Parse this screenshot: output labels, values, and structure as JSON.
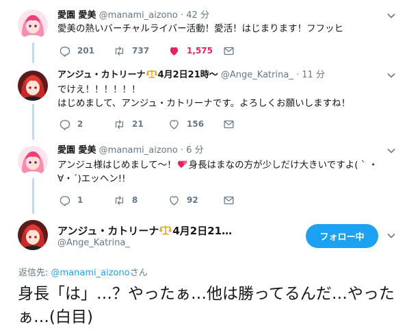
{
  "tweets": [
    {
      "name": "愛園 愛美",
      "handle": "@manami_aizono",
      "sep": "·",
      "time": "42 分",
      "lines": [
        "愛美の熱いバーチャルライバー活動！愛活！はじまります！フフッヒ"
      ],
      "replies": "201",
      "retweets": "737",
      "likes": "1,575",
      "liked": true
    },
    {
      "name": "アンジュ・カトリーナ",
      "name_suffix": "4月2日21時〜",
      "handle": "@Ange_Katrina_",
      "sep": "·",
      "time": "11 分",
      "lines": [
        "でけえ！！！！！！",
        "はじめまして、アンジュ・カトリーナです。よろしくお願いしますね！"
      ],
      "replies": "2",
      "retweets": "21",
      "likes": "156",
      "liked": false
    },
    {
      "name": "愛園 愛美",
      "handle": "@manami_aizono",
      "sep": "·",
      "time": "6 分",
      "line1_before": "アンジュ様はじめまして〜！",
      "line1_after": "身長はまなの方が少しだけ大きいですよ( ` ・",
      "line2": "∀・´)エッヘン!!",
      "replies": "1",
      "retweets": "8",
      "likes": "92",
      "liked": false
    }
  ],
  "main_tweet": {
    "name": "アンジュ・カトリーナ",
    "name_suffix": "4月2日21…",
    "handle": "@Ange_Katrina_",
    "follow_label": "フォロー中",
    "reply_prefix": "返信先: ",
    "reply_mention": "@manami_aizono",
    "reply_suffix": "さん",
    "text": "身長「は」…？やったぁ…他は勝ってるんだ…やったぁ…(白目)"
  },
  "colors": {
    "accent": "#1da1f2",
    "like": "#e0245e",
    "thread_line": "#b3e0f7",
    "muted": "#657786"
  },
  "icons": {
    "reply": "reply-icon",
    "retweet": "retweet-icon",
    "like": "heart-icon",
    "dm": "envelope-icon",
    "more": "chevron-down-icon",
    "badge": "libra-scales-icon",
    "emoji": "two-hearts-emoji"
  }
}
